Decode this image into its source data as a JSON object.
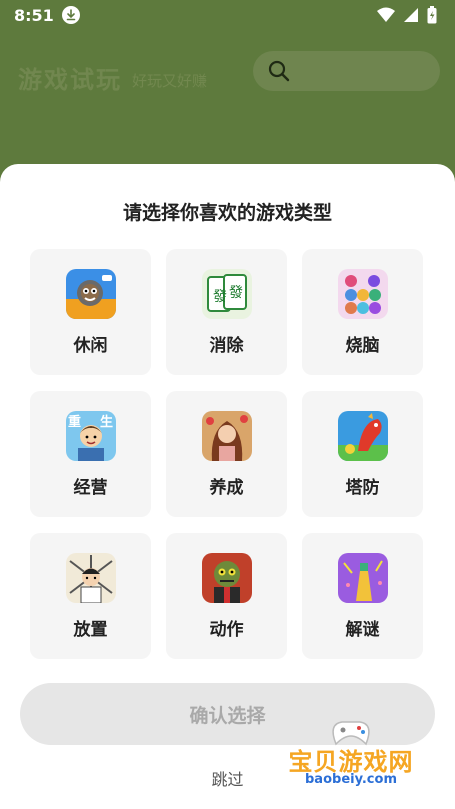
{
  "status_bar": {
    "time": "8:51"
  },
  "header": {
    "title": "游戏试玩",
    "slogan": "好玩又好赚"
  },
  "sheet": {
    "title": "请选择你喜欢的游戏类型",
    "categories": [
      {
        "label": "休闲",
        "icon": "casual-game-icon"
      },
      {
        "label": "消除",
        "icon": "mahjong-tile-icon"
      },
      {
        "label": "烧脑",
        "icon": "puzzle-icon"
      },
      {
        "label": "经营",
        "icon": "business-icon"
      },
      {
        "label": "养成",
        "icon": "character-raising-icon"
      },
      {
        "label": "塔防",
        "icon": "tower-defense-icon"
      },
      {
        "label": "放置",
        "icon": "idle-game-icon"
      },
      {
        "label": "动作",
        "icon": "action-game-icon"
      },
      {
        "label": "解谜",
        "icon": "riddle-game-icon"
      }
    ],
    "confirm_label": "确认选择",
    "skip_label": "跳过"
  },
  "watermark": {
    "text": "宝贝游戏网",
    "url": "baobeiy.com"
  }
}
